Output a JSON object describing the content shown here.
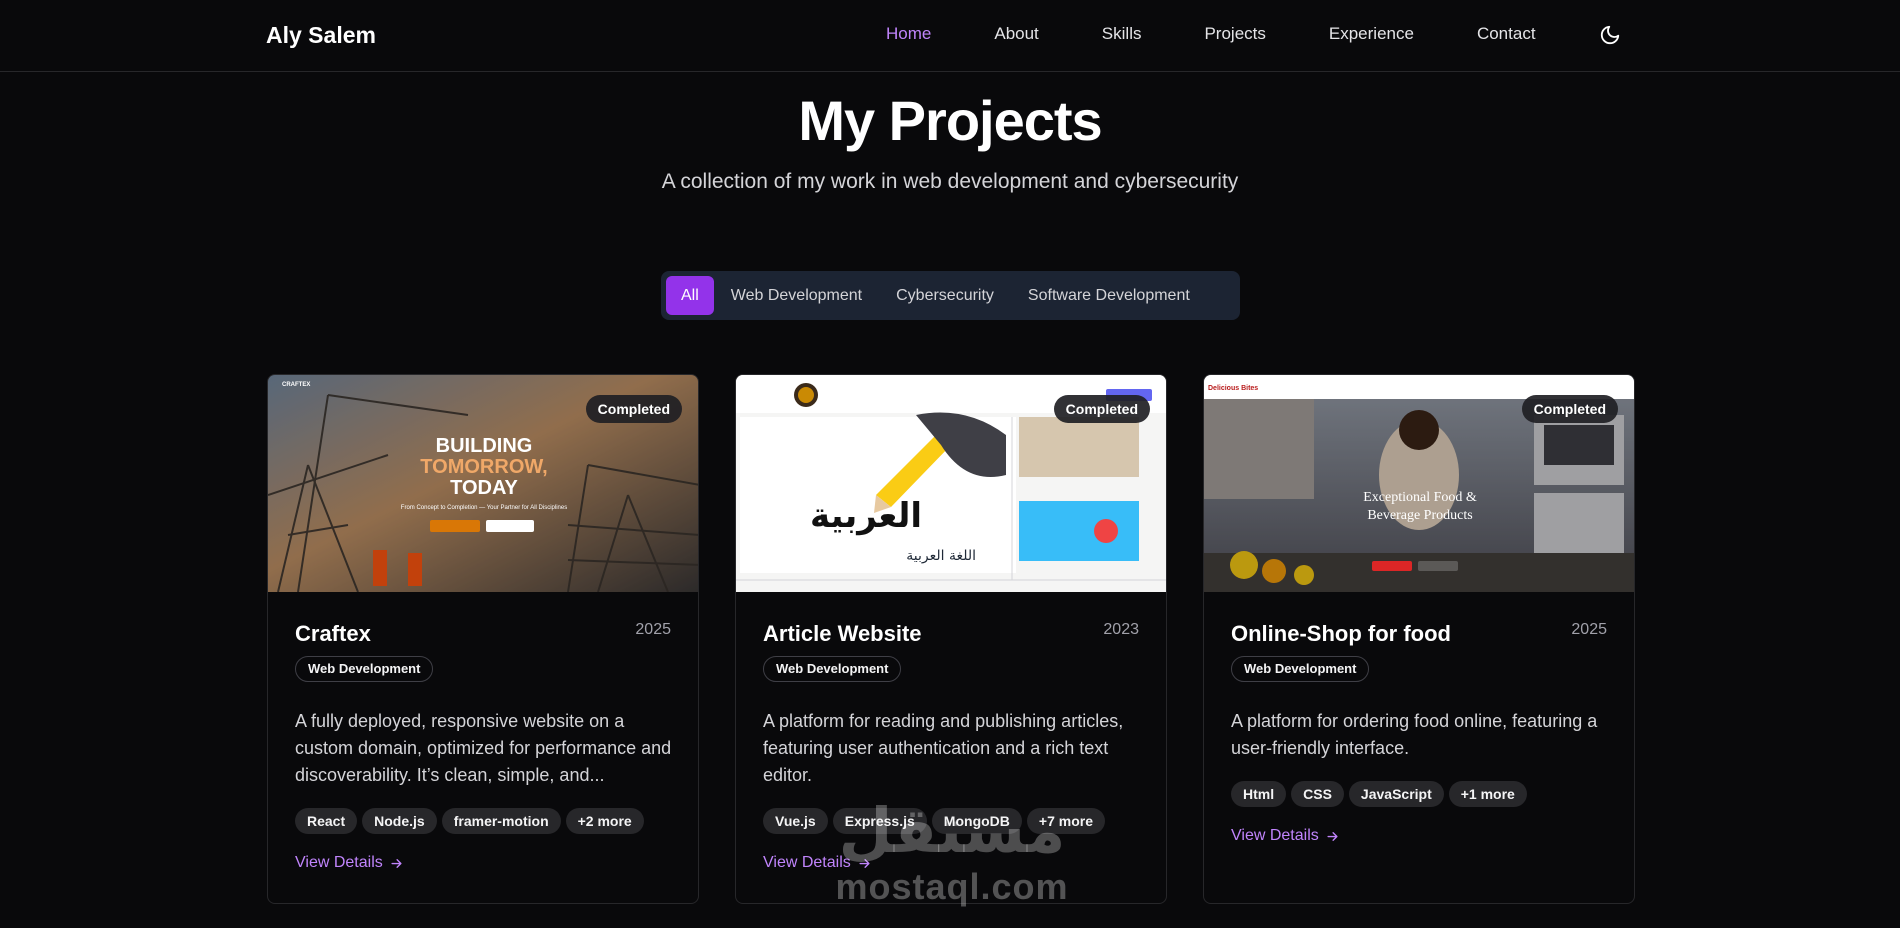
{
  "nav": {
    "brand": "Aly Salem",
    "links": [
      "Home",
      "About",
      "Skills",
      "Projects",
      "Experience",
      "Contact"
    ],
    "active": "Home",
    "theme_icon": "moon-icon"
  },
  "hero": {
    "title": "My Projects",
    "subtitle": "A collection of my work in web development and cybersecurity"
  },
  "filters": {
    "tabs": [
      "All",
      "Web Development",
      "Cybersecurity",
      "Software Development"
    ],
    "active": "All"
  },
  "colors": {
    "accent": "#9333ea",
    "link": "#c084fc",
    "background": "#09090b"
  },
  "projects": [
    {
      "title": "Craftex",
      "year": "2025",
      "status": "Completed",
      "category": "Web Development",
      "description": "A fully deployed, responsive website on a custom domain, optimized for performance and discoverability. It’s clean, simple, and...",
      "tech": [
        "React",
        "Node.js",
        "framer-motion",
        "+2 more"
      ],
      "link": "View Details",
      "preview": {
        "logo": "CRAFTEX",
        "headline_1": "BUILDING",
        "headline_2": "TOMORROW,",
        "headline_3": "TODAY",
        "tagline": "From Concept to Completion — Your Partner for All Disciplines"
      }
    },
    {
      "title": "Article Website",
      "year": "2023",
      "status": "Completed",
      "category": "Web Development",
      "description": "A platform for reading and publishing articles, featuring user authentication and a rich text editor.",
      "tech": [
        "Vue.js",
        "Express.js",
        "MongoDB",
        "+7 more"
      ],
      "link": "View Details",
      "preview": {
        "caption": "اللغة العربية",
        "calligraphy": "العربية"
      }
    },
    {
      "title": "Online-Shop for food",
      "year": "2025",
      "status": "Completed",
      "category": "Web Development",
      "description": "A platform for ordering food online, featuring a user-friendly interface.",
      "tech": [
        "Html",
        "CSS",
        "JavaScript",
        "+1 more"
      ],
      "link": "View Details",
      "preview": {
        "logo": "Delicious Bites",
        "headline_1": "Exceptional Food &",
        "headline_2": "Beverage Products"
      }
    }
  ],
  "watermark": {
    "arabic": "مستقل",
    "latin": "mostaql.com"
  }
}
